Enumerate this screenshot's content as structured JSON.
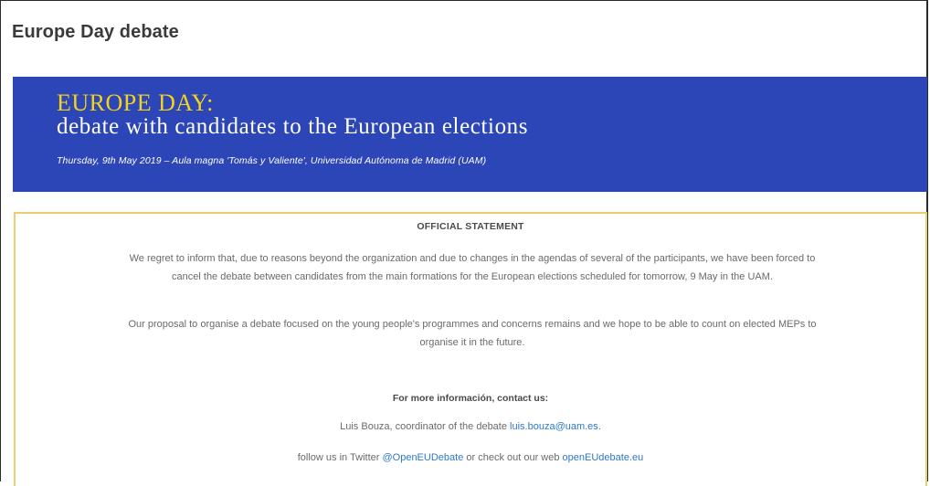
{
  "page": {
    "title": "Europe Day debate"
  },
  "banner": {
    "title": "EUROPE DAY:",
    "subtitle": "debate with candidates to the European elections",
    "date_line": "Thursday, 9th May 2019 – Aula magna 'Tomás y Valiente', Universidad Autónoma de Madrid (UAM)",
    "background": "#2d46b7",
    "title_color": "#f2d21a"
  },
  "statement": {
    "heading": "OFFICIAL STATEMENT",
    "paragraph1": "We regret to inform that, due to reasons beyond the organization and due to changes in the agendas of several of the participants, we have been forced to cancel the debate between candidates from the main formations for the European elections scheduled for tomorrow, 9 May in the UAM.",
    "paragraph2": "Our proposal to organise a debate focused on the young people's programmes and concerns remains and we hope to be able to count on elected MEPs to organise it in the future.",
    "border_color": "#e9cd6f"
  },
  "contact": {
    "heading": "For more información, contact us:",
    "coordinator_prefix": "Luis Bouza, coordinator of the debate ",
    "coordinator_email": "luis.bouza@uam.es",
    "coordinator_suffix": ".",
    "follow_prefix": "follow us in Twitter ",
    "twitter_handle": "@OpenEUDebate",
    "follow_middle": " or check out our web ",
    "website": "openEUdebate.eu",
    "link_color": "#2f78c4"
  }
}
